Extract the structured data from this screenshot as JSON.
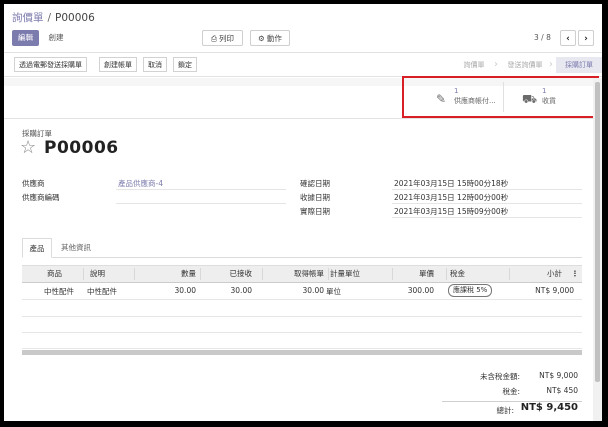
{
  "breadcrumb": {
    "parent": "詢價單",
    "separator": "/",
    "current": "P00006"
  },
  "toolbar": {
    "edit": "編輯",
    "create": "創建",
    "print": "列印",
    "action": "動作"
  },
  "pager": {
    "value": "3 / 8",
    "prev": "‹",
    "next": "›"
  },
  "actions": [
    "透過電郵發送採購單",
    "創建帳單",
    "取消",
    "鎖定"
  ],
  "status": {
    "steps": [
      "詢價單",
      "發送詢價單",
      "採購訂單"
    ],
    "active": "採購訂單"
  },
  "smart_buttons": [
    {
      "count": "1",
      "label": "供應商帳付...",
      "icon": "edit-bill-icon"
    },
    {
      "count": "1",
      "label": "收貨",
      "icon": "truck-icon"
    }
  ],
  "highlight_color": "#d81f26",
  "accent_color": "#7c7bad",
  "form": {
    "kind": "採購訂單",
    "title": "P00006",
    "fields_left": [
      {
        "label": "供應商",
        "value": "產品供應商-4"
      },
      {
        "label": "供應商編碼",
        "value": ""
      }
    ],
    "fields_right": [
      {
        "label": "確認日期",
        "value": "2021年03月15日 15時00分18秒"
      },
      {
        "label": "收據日期",
        "value": "2021年03月15日 12時00分00秒"
      },
      {
        "label": "實際日期",
        "value": "2021年03月15日 15時09分00秒"
      }
    ]
  },
  "tabs": [
    "產品",
    "其他資訊"
  ],
  "table": {
    "columns": [
      "商品",
      "說明",
      "數量",
      "已接收",
      "取得帳單",
      "計量單位",
      "單價",
      "稅金",
      "小計"
    ],
    "rows": [
      {
        "product": "中性配件",
        "description": "中性配件",
        "qty": "30.00",
        "received": "30.00",
        "billed": "30.00",
        "uom": "單位",
        "price": "300.00",
        "tax": "應課稅 5%",
        "subtotal": "NT$ 9,000"
      }
    ]
  },
  "totals": [
    {
      "label": "未含稅金額:",
      "value": "NT$ 9,000"
    },
    {
      "label": "稅金:",
      "value": "NT$ 450"
    },
    {
      "label": "總計:",
      "value": "NT$ 9,450"
    }
  ]
}
